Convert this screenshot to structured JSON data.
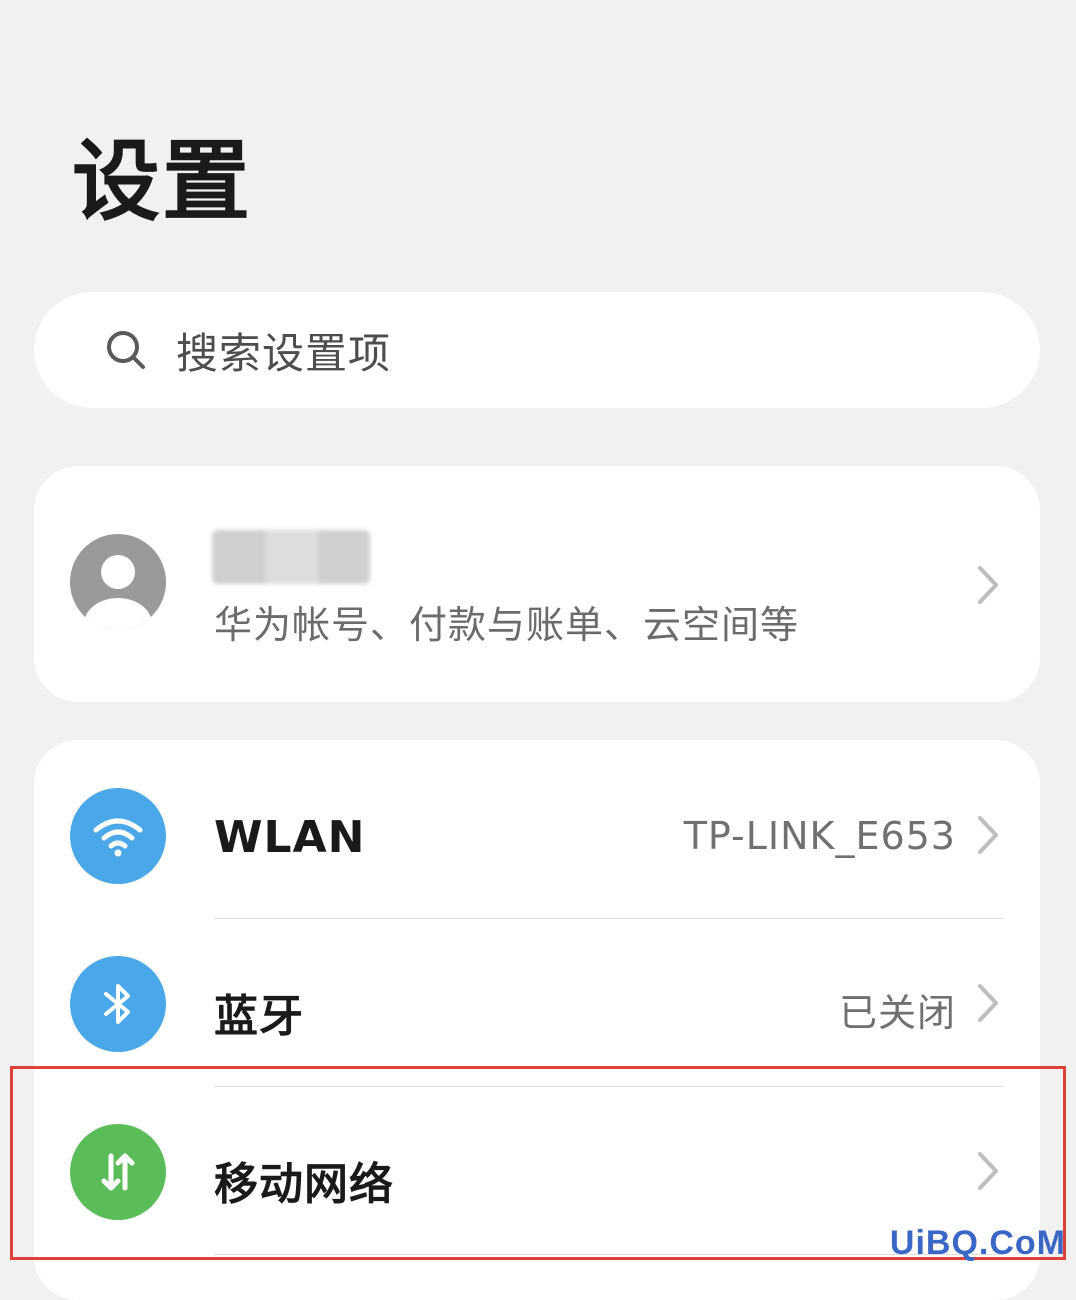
{
  "page": {
    "title": "设置"
  },
  "search": {
    "placeholder": "搜索设置项"
  },
  "account": {
    "subtitle": "华为帐号、付款与账单、云空间等"
  },
  "settings": [
    {
      "id": "wlan",
      "label": "WLAN",
      "value": "TP-LINK_E653",
      "icon": "wifi-icon",
      "color": "#4aa8e8"
    },
    {
      "id": "bluetooth",
      "label": "蓝牙",
      "value": "已关闭",
      "icon": "bluetooth-icon",
      "color": "#4aa8e8"
    },
    {
      "id": "mobile-network",
      "label": "移动网络",
      "value": "",
      "icon": "mobile-data-icon",
      "color": "#5bbd5a"
    }
  ],
  "highlight": {
    "color": "#e0403a"
  },
  "watermark": {
    "text": "UiBQ.CoM"
  }
}
